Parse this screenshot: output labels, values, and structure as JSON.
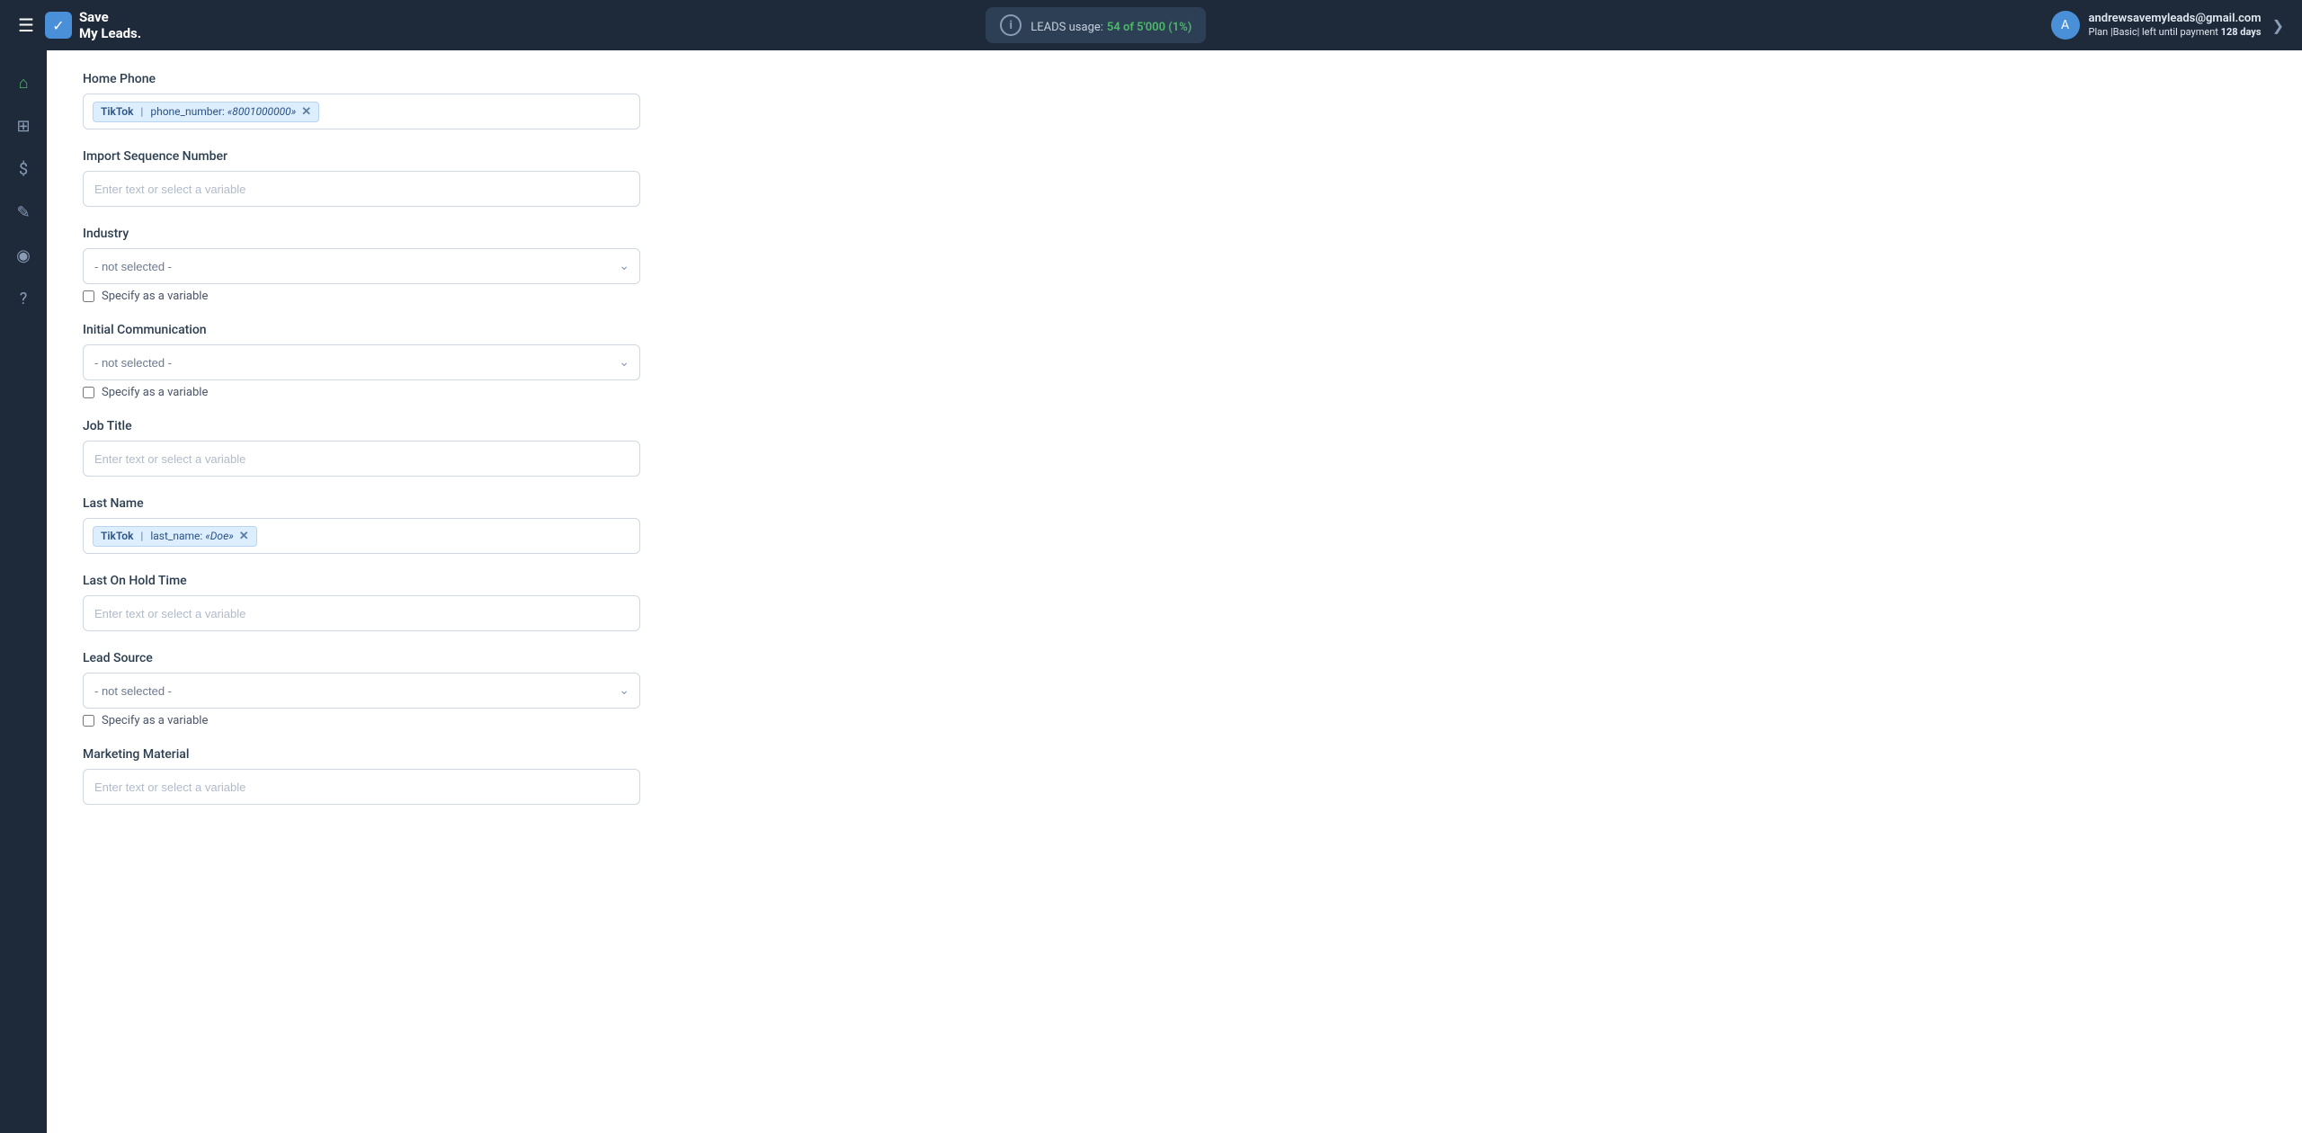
{
  "app": {
    "name": "Save",
    "name2": "My Leads.",
    "hamburger": "☰",
    "logo_check": "✓"
  },
  "header": {
    "leads_usage_label": "LEADS usage:",
    "leads_count": "54 of 5'000 (1%)",
    "user_email": "andrewsavemyleads@gmail.com",
    "plan_text": "Plan |Basic| left until payment",
    "days": "128 days",
    "chevron": "❯"
  },
  "sidebar": {
    "items": [
      {
        "icon": "⌂",
        "label": "home-icon"
      },
      {
        "icon": "⊞",
        "label": "integrations-icon"
      },
      {
        "icon": "$",
        "label": "billing-icon"
      },
      {
        "icon": "✎",
        "label": "tools-icon"
      },
      {
        "icon": "◉",
        "label": "account-icon"
      },
      {
        "icon": "?",
        "label": "help-icon"
      }
    ]
  },
  "form": {
    "fields": [
      {
        "id": "home_phone",
        "label": "Home Phone",
        "type": "tag",
        "tag": {
          "source": "TikTok",
          "separator": "|",
          "key": "phone_number:",
          "value": "«8001000000»"
        }
      },
      {
        "id": "import_sequence_number",
        "label": "Import Sequence Number",
        "type": "text",
        "placeholder": "Enter text or select a variable"
      },
      {
        "id": "industry",
        "label": "Industry",
        "type": "select",
        "value": "- not selected -",
        "has_checkbox": true,
        "checkbox_label": "Specify as a variable"
      },
      {
        "id": "initial_communication",
        "label": "Initial Communication",
        "type": "select",
        "value": "- not selected -",
        "has_checkbox": true,
        "checkbox_label": "Specify as a variable"
      },
      {
        "id": "job_title",
        "label": "Job Title",
        "type": "text",
        "placeholder": "Enter text or select a variable"
      },
      {
        "id": "last_name",
        "label": "Last Name",
        "type": "tag",
        "tag": {
          "source": "TikTok",
          "separator": "|",
          "key": "last_name:",
          "value": "«Doe»"
        }
      },
      {
        "id": "last_on_hold_time",
        "label": "Last On Hold Time",
        "type": "text",
        "placeholder": "Enter text or select a variable"
      },
      {
        "id": "lead_source",
        "label": "Lead Source",
        "type": "select",
        "value": "- not selected -",
        "has_checkbox": true,
        "checkbox_label": "Specify as a variable"
      },
      {
        "id": "marketing_material",
        "label": "Marketing Material",
        "type": "text",
        "placeholder": "Enter text or select a variable"
      }
    ]
  }
}
